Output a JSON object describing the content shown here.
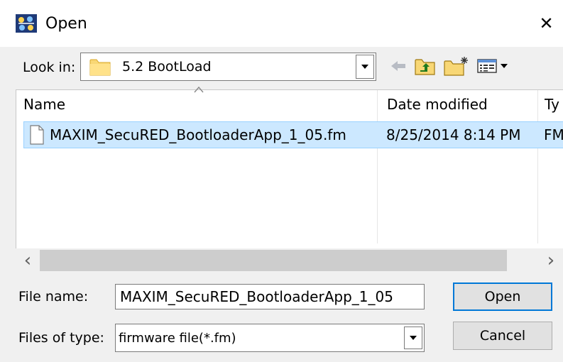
{
  "window": {
    "title": "Open",
    "close_glyph": "✕",
    "accent": "#0078d7"
  },
  "lookin": {
    "label": "Look in:",
    "value": "5.2 BootLoad"
  },
  "toolbar": {
    "back": "back-arrow-icon",
    "up": "up-one-level-icon",
    "new_folder": "new-folder-icon",
    "view_menu": "view-menu-icon"
  },
  "list": {
    "columns": [
      "Name",
      "Date modified",
      "Ty"
    ],
    "rows": [
      {
        "name": "MAXIM_SecuRED_BootloaderApp_1_05.fm",
        "date": "8/25/2014 8:14 PM",
        "type": "FM"
      }
    ],
    "selection_color": "#cce8ff"
  },
  "scroll": {
    "left": "‹",
    "right": "›"
  },
  "filename": {
    "label": "File name:",
    "value": "MAXIM_SecuRED_BootloaderApp_1_05"
  },
  "filetype": {
    "label": "Files of type:",
    "value": "firmware file(*.fm)"
  },
  "buttons": {
    "open": "Open",
    "cancel": "Cancel"
  }
}
